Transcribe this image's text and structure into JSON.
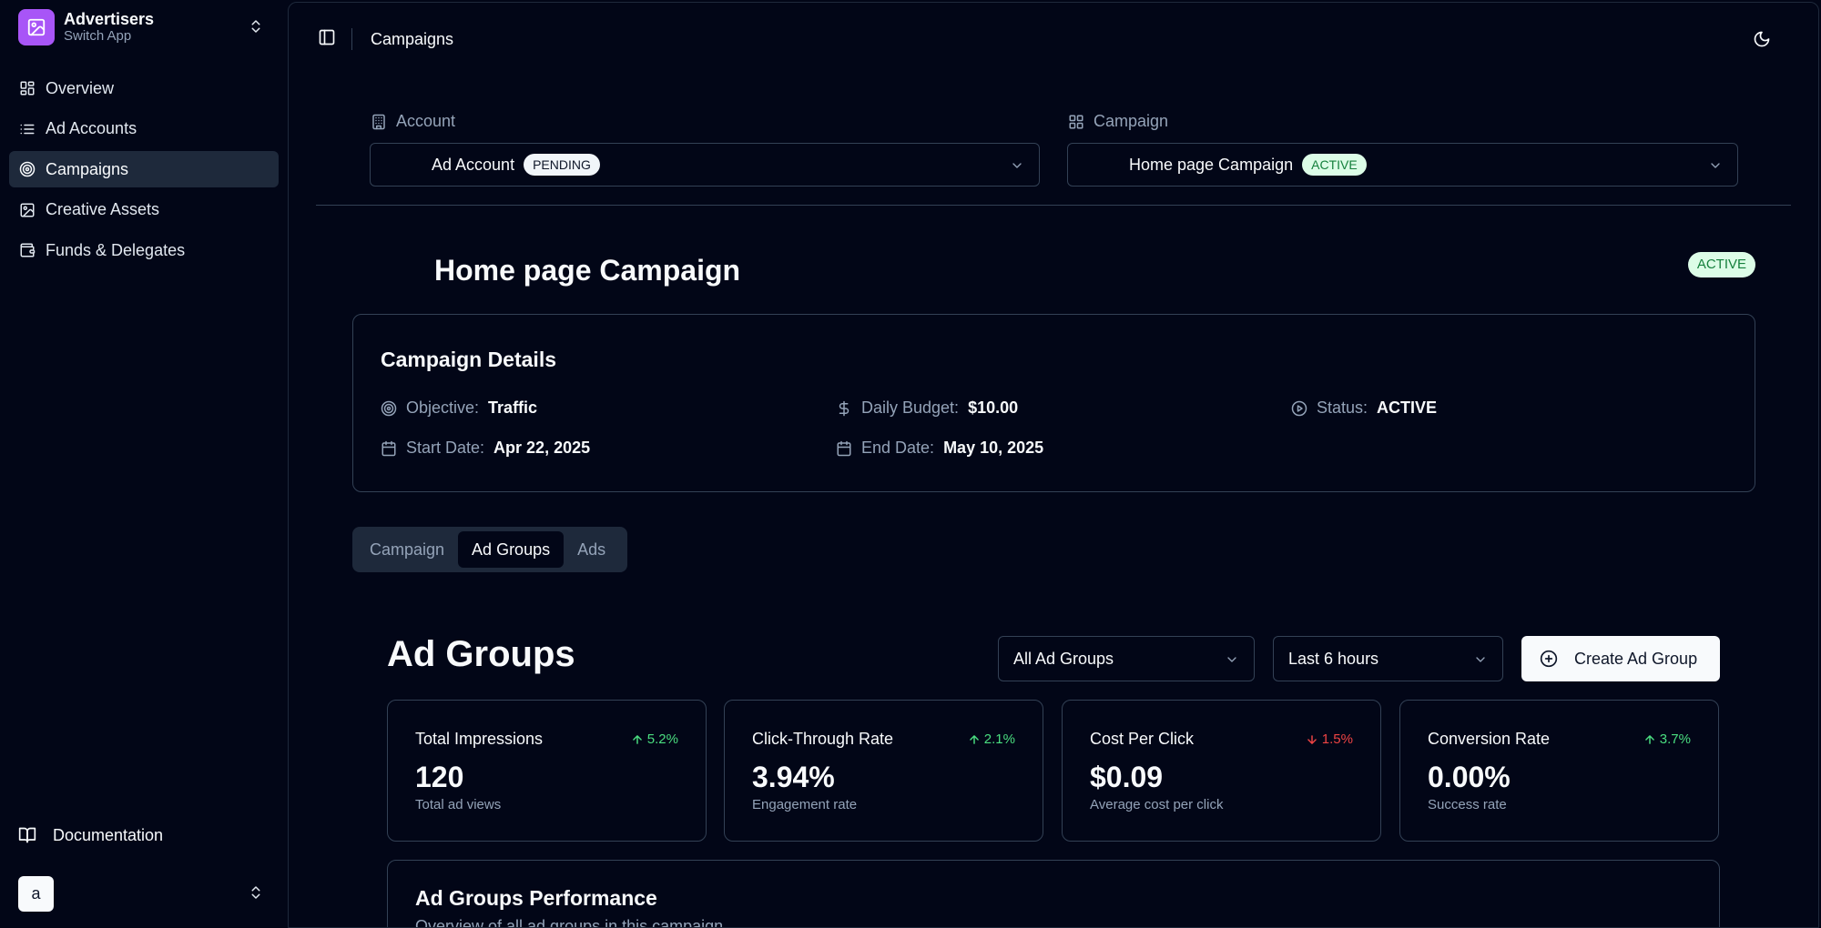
{
  "app": {
    "name": "Advertisers",
    "subtitle": "Switch App",
    "accent": "#a855f7"
  },
  "sidebar": {
    "items": [
      {
        "label": "Overview",
        "icon": "layout-dashboard-icon"
      },
      {
        "label": "Ad Accounts",
        "icon": "list-icon"
      },
      {
        "label": "Campaigns",
        "icon": "target-icon",
        "active": true
      },
      {
        "label": "Creative Assets",
        "icon": "image-icon"
      },
      {
        "label": "Funds & Delegates",
        "icon": "wallet-icon"
      }
    ],
    "documentation": "Documentation",
    "user_initial": "a"
  },
  "header": {
    "breadcrumb": "Campaigns"
  },
  "account_selector": {
    "label": "Account",
    "value": "Ad Account",
    "badge": "PENDING"
  },
  "campaign_selector": {
    "label": "Campaign",
    "value": "Home page Campaign",
    "badge": "ACTIVE"
  },
  "campaign": {
    "title": "Home page Campaign",
    "status_badge": "ACTIVE",
    "details_title": "Campaign Details",
    "objective_label": "Objective:",
    "objective": "Traffic",
    "budget_label": "Daily Budget:",
    "budget": "$10.00",
    "status_label": "Status:",
    "status": "ACTIVE",
    "start_label": "Start Date:",
    "start": "Apr 22, 2025",
    "end_label": "End Date:",
    "end": "May 10, 2025"
  },
  "tabs": [
    {
      "label": "Campaign"
    },
    {
      "label": "Ad Groups",
      "active": true
    },
    {
      "label": "Ads"
    }
  ],
  "ad_groups": {
    "title": "Ad Groups",
    "filter": "All Ad Groups",
    "range": "Last 6 hours",
    "create_label": "Create Ad Group",
    "metrics": [
      {
        "title": "Total Impressions",
        "trend": "5.2%",
        "direction": "up",
        "value": "120",
        "sub": "Total ad views"
      },
      {
        "title": "Click-Through Rate",
        "trend": "2.1%",
        "direction": "up",
        "value": "3.94%",
        "sub": "Engagement rate"
      },
      {
        "title": "Cost Per Click",
        "trend": "1.5%",
        "direction": "down",
        "value": "$0.09",
        "sub": "Average cost per click"
      },
      {
        "title": "Conversion Rate",
        "trend": "3.7%",
        "direction": "up",
        "value": "0.00%",
        "sub": "Success rate"
      }
    ],
    "performance_title": "Ad Groups Performance",
    "performance_sub": "Overview of all ad groups in this campaign"
  },
  "colors": {
    "background": "#020617",
    "border": "#334155",
    "up": "#4ade80",
    "down": "#ef4444",
    "active_badge_bg": "#dcfce7",
    "active_badge_fg": "#15803d"
  }
}
